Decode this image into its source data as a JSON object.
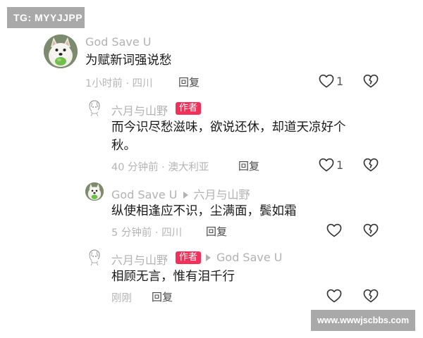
{
  "watermarks": {
    "top_left": "TG: MYYJJPP",
    "bottom_right": "www.wwwjscbbs.com"
  },
  "author_badge": "作者",
  "colors": {
    "badge": "#f0325a",
    "meta": "#b5b5b5",
    "name": "#b2b2b2"
  },
  "comments": [
    {
      "user": "God Save U",
      "avatar": "dog-avatar",
      "text": "为赋新词强说愁",
      "meta": "1小时前 · 四川",
      "reply": "回复",
      "likes": "1"
    },
    {
      "user": "六月与山野",
      "avatar": "sketch-avatar",
      "is_author": true,
      "text_line1": "而今识尽愁滋味，欲说还休，却道天凉好个",
      "text_line2": "秋。",
      "meta": "40 分钟前 · 澳大利亚",
      "reply": "回复",
      "likes": "1"
    },
    {
      "user": "God Save U",
      "avatar": "dog-avatar",
      "reply_to": "六月与山野",
      "text": "纵使相逢应不识，尘满面，鬓如霜",
      "meta": "5 分钟前 · 四川",
      "reply": "回复"
    },
    {
      "user": "六月与山野",
      "avatar": "sketch-avatar",
      "is_author": true,
      "reply_to": "God Save U",
      "text": "相顾无言，惟有泪千行",
      "meta": "刚刚",
      "reply": "回复"
    }
  ]
}
